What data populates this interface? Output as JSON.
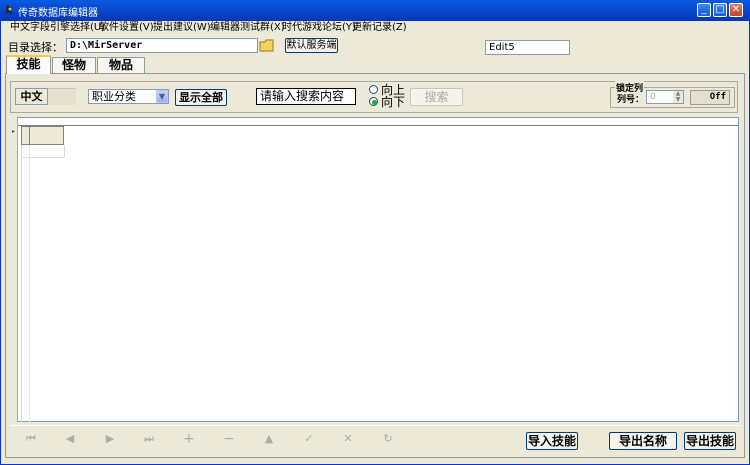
{
  "window": {
    "title": "传奇数据库编辑器"
  },
  "menu": [
    "中文字段引擎选择(U)",
    "软件设置(V)",
    "提出建议(W)",
    "编辑器测试群(X)",
    "时代游戏论坛(Y)",
    "更新记录(Z)"
  ],
  "toolbar": {
    "dir_label": "目录选择：",
    "dir_value": "D:\\MirServer",
    "default_server_button": "默认服务端",
    "edit5_value": "Edit5"
  },
  "tabs": [
    "技能",
    "怪物",
    "物品"
  ],
  "filter": {
    "lang_label": "中文",
    "category_value": "职业分类",
    "show_all_button": "显示全部",
    "search_input_value": "请输入搜索内容",
    "radio_up": "向上",
    "radio_down": "向下",
    "search_button": "搜索",
    "lock_col_title": "锁定列",
    "col_num_label": "列号：",
    "col_num_value": "0",
    "toggle_value": "Off"
  },
  "bottom": {
    "import_skill_button": "导入技能",
    "export_name_button": "导出名称",
    "export_skill_button": "导出技能"
  },
  "nav_icons": [
    "first-icon",
    "prior-icon",
    "next-icon",
    "last-icon",
    "insert-icon",
    "delete-icon",
    "edit-icon",
    "post-icon",
    "cancel-icon",
    "refresh-icon"
  ]
}
